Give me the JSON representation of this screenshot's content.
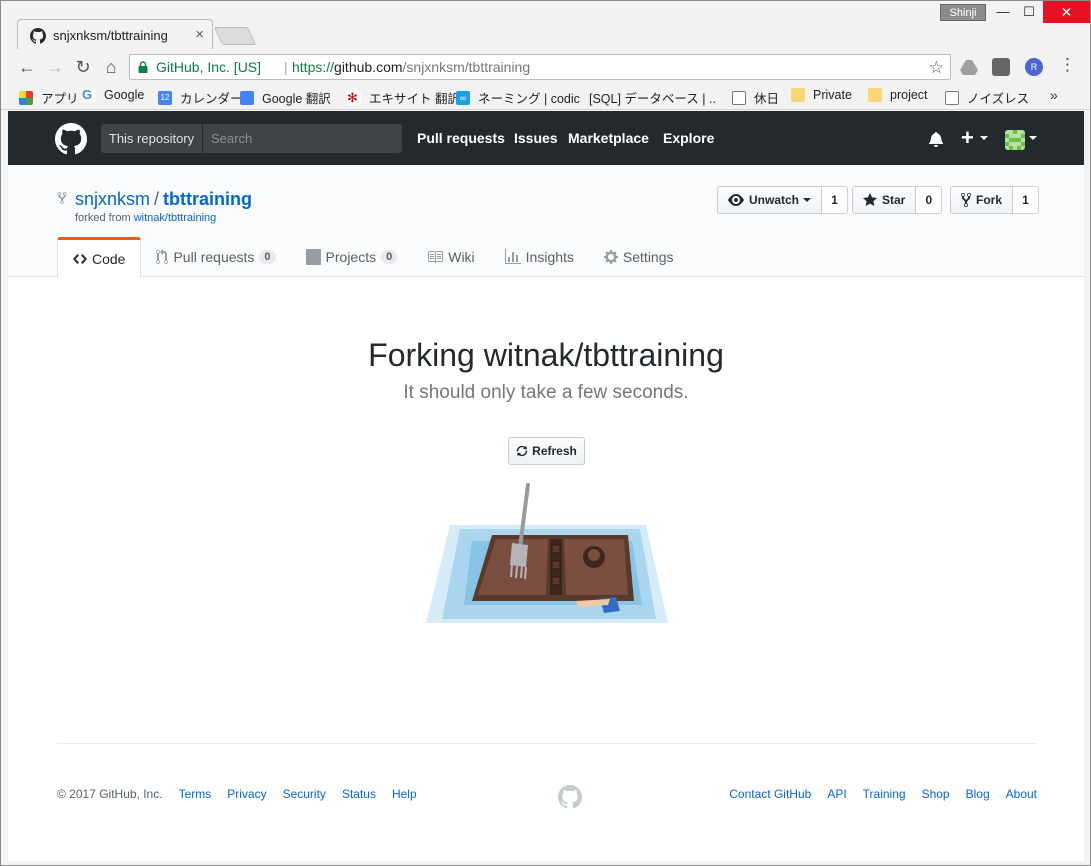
{
  "browser": {
    "tab": {
      "title": "snjxnksm/tbttraining",
      "close": "×"
    },
    "user_chip": "Shinji",
    "window_buttons": {
      "minimize": "—",
      "maximize": "☐",
      "close": "✕"
    },
    "omnibox": {
      "ev_name": "GitHub, Inc. [US]",
      "separator": "|",
      "url_scheme": "https://",
      "url_host": "github.com",
      "url_path": "/snjxnksm/tbttraining"
    },
    "bookmarks": [
      {
        "label": "アプリ",
        "icon": "apps-grid-icon",
        "color": "#e34c26"
      },
      {
        "label": "Google",
        "icon": "google-icon",
        "color": "#4285f4"
      },
      {
        "label": "カレンダー",
        "icon": "calendar-icon",
        "color": "#4285f4"
      },
      {
        "label": "Google 翻訳",
        "icon": "translate-icon",
        "color": "#4285f4"
      },
      {
        "label": "エキサイト 翻訳",
        "icon": "excite-icon",
        "color": "#c00000"
      },
      {
        "label": "ネーミング | codic",
        "icon": "codic-icon",
        "color": "#1ba1e2"
      },
      {
        "label": "[SQL] データベース | ...",
        "icon": "sql-icon",
        "color": "#c62828"
      },
      {
        "label": "休日",
        "icon": "page-icon",
        "color": "#ffffff"
      },
      {
        "label": "Private",
        "icon": "folder-icon",
        "color": "#f7d774"
      },
      {
        "label": "project",
        "icon": "folder-icon",
        "color": "#f7d774"
      },
      {
        "label": "ノイズレス",
        "icon": "page-icon",
        "color": "#ffffff"
      }
    ],
    "bookmarks_more": "»"
  },
  "header": {
    "scope_label": "This repository",
    "search_placeholder": "Search",
    "nav": [
      "Pull requests",
      "Issues",
      "Marketplace",
      "Explore"
    ],
    "plus": "+"
  },
  "repo": {
    "owner": "snjxnksm",
    "separator": "/",
    "name": "tbttraining",
    "forked_from_prefix": "forked from",
    "forked_from": "witnak/tbttraining",
    "actions": [
      {
        "label": "Unwatch",
        "count": "1",
        "icon": "eye-icon",
        "caret": true
      },
      {
        "label": "Star",
        "count": "0",
        "icon": "star-icon",
        "caret": false
      },
      {
        "label": "Fork",
        "count": "1",
        "icon": "repo-forked-icon",
        "caret": false
      }
    ],
    "tabs": [
      {
        "label": "Code",
        "icon": "code-icon",
        "counter": null
      },
      {
        "label": "Pull requests",
        "icon": "git-pull-request-icon",
        "counter": "0"
      },
      {
        "label": "Projects",
        "icon": "project-icon",
        "counter": "0"
      },
      {
        "label": "Wiki",
        "icon": "book-icon",
        "counter": null
      },
      {
        "label": "Insights",
        "icon": "graph-icon",
        "counter": null
      },
      {
        "label": "Settings",
        "icon": "gear-icon",
        "counter": null
      }
    ]
  },
  "main": {
    "title": "Forking witnak/tbttraining",
    "subtitle": "It should only take a few seconds.",
    "refresh_label": "Refresh"
  },
  "footer": {
    "copyright": "© 2017 GitHub, Inc.",
    "left_links": [
      "Terms",
      "Privacy",
      "Security",
      "Status",
      "Help"
    ],
    "right_links": [
      "Contact GitHub",
      "API",
      "Training",
      "Shop",
      "Blog",
      "About"
    ]
  },
  "colors": {
    "header_bg": "#24292e",
    "link": "#0366d6",
    "tab_accent": "#e36209",
    "ev_green": "#0b8043"
  }
}
